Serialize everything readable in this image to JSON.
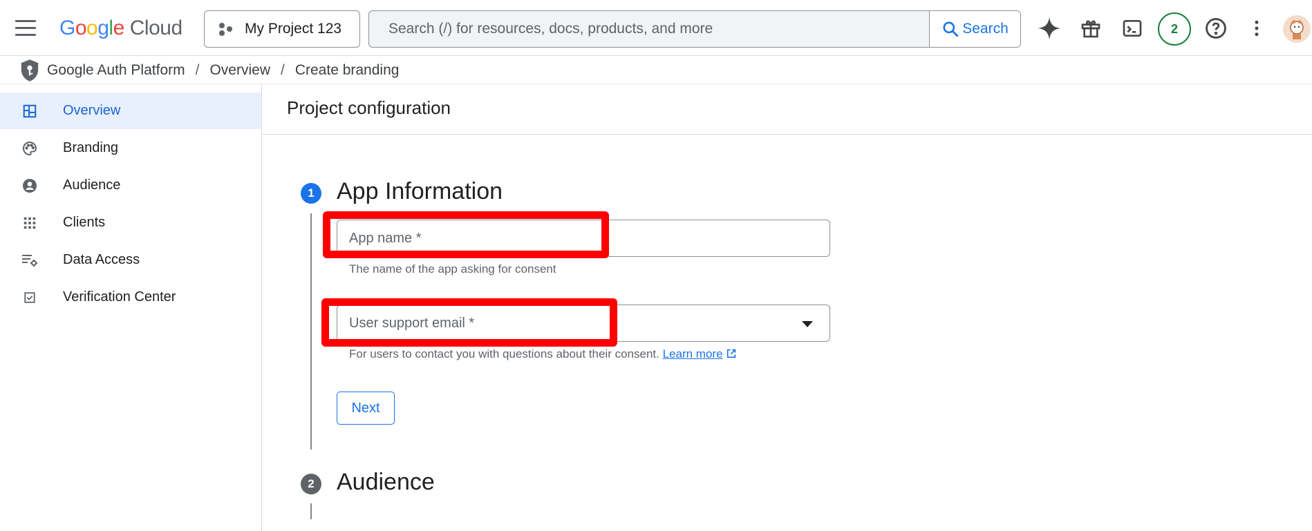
{
  "topbar": {
    "logo_letters": [
      "G",
      "o",
      "o",
      "g",
      "l",
      "e"
    ],
    "logo_product": "Cloud",
    "project_label": "My Project 123",
    "search_placeholder": "Search (/) for resources, docs, products, and more",
    "search_button": "Search",
    "notification_count": "2",
    "icons": [
      "menu-icon",
      "gemini-icon",
      "gift-icon",
      "cloud-shell-icon",
      "help-icon",
      "more-vert-icon",
      "avatar"
    ]
  },
  "breadcrumb": {
    "items": [
      "Google Auth Platform",
      "Overview",
      "Create branding"
    ],
    "separator": "/"
  },
  "sidebar": {
    "items": [
      {
        "label": "Overview",
        "icon": "dashboard-icon",
        "active": true
      },
      {
        "label": "Branding",
        "icon": "palette-icon",
        "active": false
      },
      {
        "label": "Audience",
        "icon": "account-circle-icon",
        "active": false
      },
      {
        "label": "Clients",
        "icon": "apps-grid-icon",
        "active": false
      },
      {
        "label": "Data Access",
        "icon": "data-settings-icon",
        "active": false
      },
      {
        "label": "Verification Center",
        "icon": "check-box-icon",
        "active": false
      }
    ]
  },
  "main": {
    "title": "Project configuration",
    "steps": [
      {
        "number": "1",
        "title": "App Information",
        "active": true
      },
      {
        "number": "2",
        "title": "Audience",
        "active": false
      }
    ],
    "form": {
      "app_name_label": "App name *",
      "app_name_hint": "The name of the app asking for consent",
      "support_email_label": "User support email *",
      "support_email_hint": "For users to contact you with questions about their consent.",
      "learn_more": "Learn more",
      "next_button": "Next"
    }
  },
  "colors": {
    "accent": "#1a73e8",
    "active_bg": "#e8f0fe",
    "highlight_box": "#ff0000",
    "badge_green": "#188038",
    "step_inactive": "#5f6368"
  }
}
